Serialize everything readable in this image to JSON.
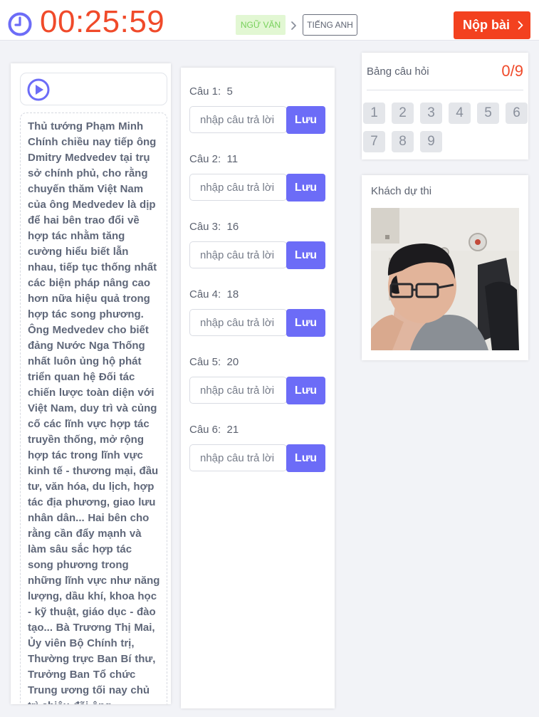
{
  "header": {
    "timer": "00:25:59",
    "subject_active": "NGỮ VĂN",
    "subject_next": "TIẾNG ANH",
    "submit_label": "Nộp bài",
    "colors": {
      "timer": "#f04a2a",
      "accent": "#6c6cf7",
      "submit": "#f3411f"
    }
  },
  "passage": {
    "text": "Thủ tướng Phạm Minh Chính chiều nay tiếp ông Dmitry Medvedev tại trụ sở chính phủ, cho rằng chuyến thăm Việt Nam của ông Medvedev là dịp để hai bên trao đổi về hợp tác nhằm tăng cường hiểu biết lẫn nhau, tiếp tục thống nhất các biện pháp nâng cao hơn nữa hiệu quả trong hợp tác song phương. Ông Medvedev cho biết đảng Nước Nga Thống nhất luôn ủng hộ phát triển quan hệ Đối tác chiến lược toàn diện với Việt Nam, duy trì và củng cố các lĩnh vực hợp tác truyền thống, mở rộng hợp tác trong lĩnh vực kinh tế - thương mại, đầu tư, văn hóa, du lịch, hợp tác địa phương, giao lưu nhân dân... Hai bên cho rằng cần đẩy mạnh và làm sâu sắc hợp tác song phương trong những lĩnh vực như năng lượng, dầu khí, khoa học - kỹ thuật, giáo dục - đào tạo... Bà Trương Thị Mai, Ủy viên Bộ Chính trị, Thường trực Ban Bí thư, Trưởng Ban Tổ chức Trung ương tối nay chủ trì chiêu đãi ông"
  },
  "answers": {
    "save_label": "Lưu",
    "placeholder": "nhập câu trả lời",
    "questions": [
      {
        "label": "Câu 1:",
        "number": "5",
        "value": ""
      },
      {
        "label": "Câu 2:",
        "number": "11",
        "value": ""
      },
      {
        "label": "Câu 3:",
        "number": "16",
        "value": ""
      },
      {
        "label": "Câu 4:",
        "number": "18",
        "value": ""
      },
      {
        "label": "Câu 5:",
        "number": "20",
        "value": ""
      },
      {
        "label": "Câu 6:",
        "number": "21",
        "value": ""
      }
    ]
  },
  "board": {
    "title": "Bảng câu hỏi",
    "count": "0/9",
    "numbers": [
      "1",
      "2",
      "3",
      "4",
      "5",
      "6",
      "7",
      "8",
      "9"
    ]
  },
  "candidate": {
    "title": "Khách dự thi"
  }
}
